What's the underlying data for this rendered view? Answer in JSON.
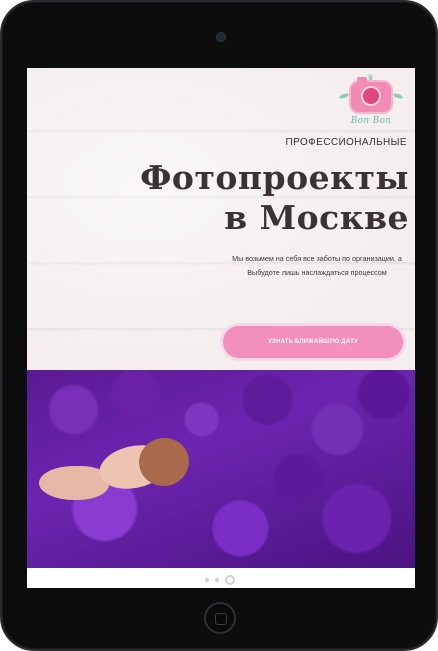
{
  "logo": {
    "text": "Bon Bon"
  },
  "hero": {
    "subtitle": "ПРОФЕССИОНАЛЬНЫЕ",
    "title_line1": "Фотопроекты",
    "title_line2": "в Москве",
    "description": "Мы возьмем на себя все заботы по организации, а Выбудоте лишь наслаждаться процессом",
    "cta_label": "УЗНАТЬ БЛИЖАЙШУЮ ДАТУ"
  },
  "pagination": {
    "count": 3,
    "active_index": 2
  },
  "colors": {
    "accent_pink": "#f28fbb",
    "logo_green": "#6db9a6",
    "photo_purple": "#6c25b0",
    "bezel": "#0d0d0e"
  }
}
